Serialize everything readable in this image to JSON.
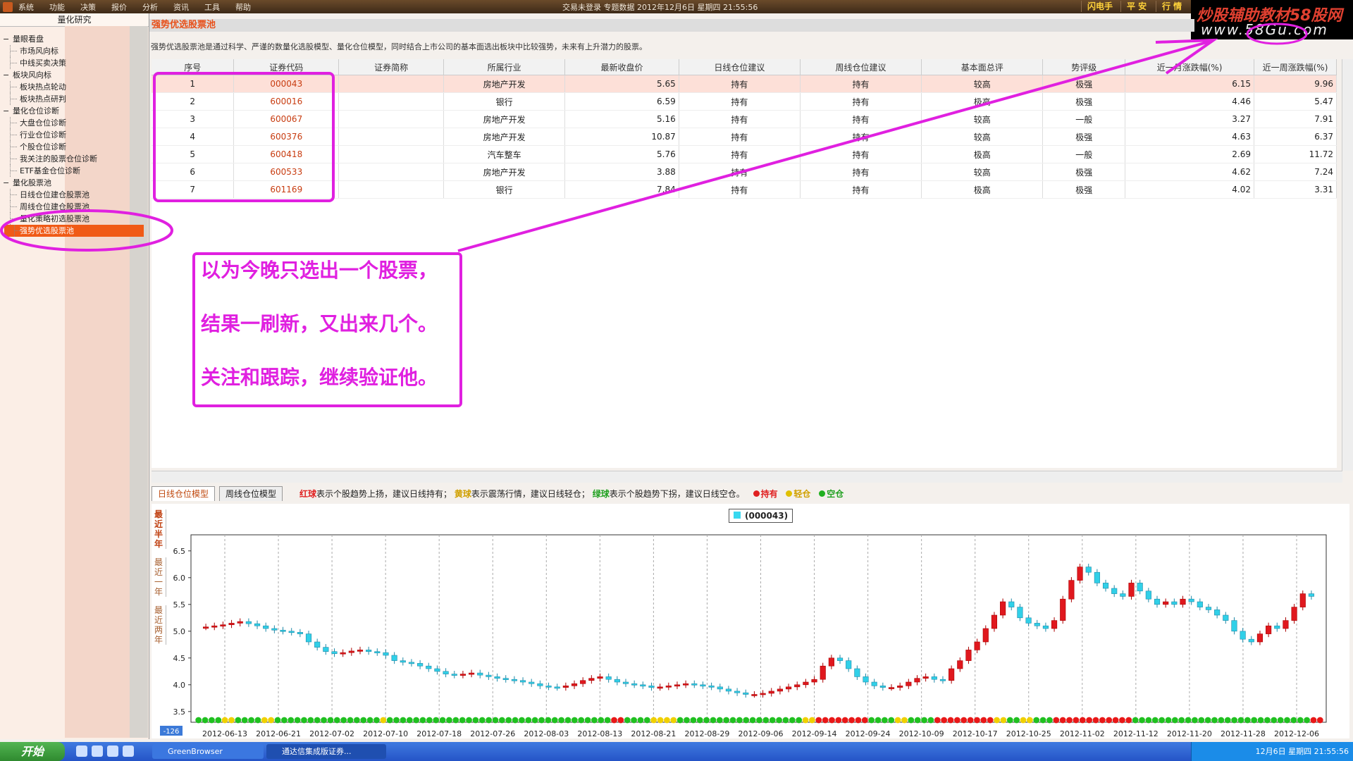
{
  "menubar": {
    "items": [
      "系统",
      "功能",
      "决策",
      "报价",
      "分析",
      "资讯",
      "工具",
      "帮助"
    ],
    "status": "交易未登录   专题数据  2012年12月6日  星期四  21:55:56",
    "right_buttons": [
      "闪电手",
      "平 安",
      "行 情"
    ]
  },
  "watermark": {
    "line1": "炒股辅助教材58股网",
    "line2": "www.58Gu.com"
  },
  "sidebar": {
    "header": "量化研究",
    "tree": [
      {
        "label": "量眼看盘",
        "level": 0
      },
      {
        "label": "市场风向标",
        "level": 1
      },
      {
        "label": "中线买卖决策",
        "level": 1
      },
      {
        "label": "板块风向标",
        "level": 0
      },
      {
        "label": "板块热点轮动",
        "level": 1
      },
      {
        "label": "板块热点研判",
        "level": 1
      },
      {
        "label": "量化仓位诊断",
        "level": 0
      },
      {
        "label": "大盘仓位诊断",
        "level": 1
      },
      {
        "label": "行业仓位诊断",
        "level": 1
      },
      {
        "label": "个股仓位诊断",
        "level": 1
      },
      {
        "label": "我关注的股票仓位诊断",
        "level": 1
      },
      {
        "label": "ETF基金仓位诊断",
        "level": 1
      },
      {
        "label": "量化股票池",
        "level": 0
      },
      {
        "label": "日线仓位建仓股票池",
        "level": 1
      },
      {
        "label": "周线仓位建仓股票池",
        "level": 1
      },
      {
        "label": "量化策略初选股票池",
        "level": 1
      },
      {
        "label": "强势优选股票池",
        "level": 1,
        "selected": true
      }
    ]
  },
  "main": {
    "title": "强势优选股票池",
    "description": "强势优选股票池是通过科学、严谨的数量化选股模型、量化仓位模型，同时结合上市公司的基本面选出板块中比较强势，未来有上升潜力的股票。"
  },
  "table": {
    "headers": [
      "序号",
      "证券代码",
      "证券简称",
      "所属行业",
      "最新收盘价",
      "日线仓位建议",
      "周线仓位建议",
      "基本面总评",
      "势评级",
      "近一月涨跌幅(%)",
      "近一周涨跌幅(%)"
    ],
    "rows": [
      [
        "1",
        "000043",
        "",
        "房地产开发",
        "5.65",
        "持有",
        "持有",
        "较高",
        "极强",
        "6.15",
        "9.96"
      ],
      [
        "2",
        "600016",
        "",
        "银行",
        "6.59",
        "持有",
        "持有",
        "极高",
        "极强",
        "4.46",
        "5.47"
      ],
      [
        "3",
        "600067",
        "",
        "房地产开发",
        "5.16",
        "持有",
        "持有",
        "较高",
        "一般",
        "3.27",
        "7.91"
      ],
      [
        "4",
        "600376",
        "",
        "房地产开发",
        "10.87",
        "持有",
        "持有",
        "较高",
        "极强",
        "4.63",
        "6.37"
      ],
      [
        "5",
        "600418",
        "",
        "汽车整车",
        "5.76",
        "持有",
        "持有",
        "极高",
        "一般",
        "2.69",
        "11.72"
      ],
      [
        "6",
        "600533",
        "",
        "房地产开发",
        "3.88",
        "持有",
        "持有",
        "较高",
        "极强",
        "4.62",
        "7.24"
      ],
      [
        "7",
        "601169",
        "",
        "银行",
        "7.84",
        "持有",
        "持有",
        "极高",
        "极强",
        "4.02",
        "3.31"
      ]
    ]
  },
  "bottom": {
    "tabs": [
      "日线仓位模型",
      "周线仓位模型"
    ],
    "legend": {
      "red": "红球",
      "red_text": "表示个股趋势上扬，建议日线持有；",
      "yellow": "黄球",
      "yellow_text": "表示震荡行情，建议日线轻仓；",
      "green": "绿球",
      "green_text": "表示个股趋势下拐，建议日线空仓。",
      "hold": "持有",
      "light": "轻仓",
      "empty": "空仓"
    },
    "side_tabs": [
      "最近半年",
      "最近一年",
      "最近两年"
    ],
    "chart_legend": "(000043)",
    "axis_marker": "-126"
  },
  "annotation": {
    "lines": [
      "以为今晚只选出一个股票，",
      "结果一刷新，又出来几个。",
      "关注和跟踪，继续验证他。"
    ]
  },
  "taskbar": {
    "start": "开始",
    "tasks": [
      "GreenBrowser",
      "通达信集成版证券..."
    ],
    "clock": "12月6日 星期四 21:55:56"
  },
  "chart_data": {
    "type": "candlestick",
    "title": "",
    "series_name": "(000043)",
    "ylim": [
      3.3,
      6.8
    ],
    "yticks": [
      3.5,
      4.0,
      4.5,
      5.0,
      5.5,
      6.0,
      6.5
    ],
    "x_labels": [
      "2012-06-13",
      "2012-06-21",
      "2012-07-02",
      "2012-07-10",
      "2012-07-18",
      "2012-07-26",
      "2012-08-03",
      "2012-08-13",
      "2012-08-21",
      "2012-08-29",
      "2012-09-06",
      "2012-09-14",
      "2012-09-24",
      "2012-10-09",
      "2012-10-17",
      "2012-10-25",
      "2012-11-02",
      "2012-11-12",
      "2012-11-20",
      "2012-11-28",
      "2012-12-06"
    ],
    "close_series": [
      5.08,
      5.1,
      5.12,
      5.15,
      5.18,
      5.14,
      5.1,
      5.05,
      5.02,
      5.0,
      4.98,
      4.95,
      4.8,
      4.7,
      4.62,
      4.58,
      4.6,
      4.63,
      4.65,
      4.62,
      4.6,
      4.55,
      4.45,
      4.42,
      4.4,
      4.35,
      4.3,
      4.25,
      4.2,
      4.18,
      4.2,
      4.22,
      4.18,
      4.15,
      4.12,
      4.1,
      4.08,
      4.05,
      4.02,
      3.98,
      3.96,
      3.95,
      3.98,
      4.02,
      4.08,
      4.12,
      4.15,
      4.1,
      4.05,
      4.02,
      4.0,
      3.98,
      3.95,
      3.96,
      3.98,
      4.0,
      4.02,
      4.0,
      3.98,
      3.96,
      3.92,
      3.88,
      3.85,
      3.82,
      3.82,
      3.84,
      3.88,
      3.92,
      3.96,
      4.0,
      4.05,
      4.1,
      4.35,
      4.5,
      4.45,
      4.3,
      4.15,
      4.05,
      3.98,
      3.95,
      3.95,
      3.98,
      4.05,
      4.12,
      4.15,
      4.1,
      4.08,
      4.3,
      4.45,
      4.65,
      4.8,
      5.05,
      5.3,
      5.55,
      5.45,
      5.25,
      5.15,
      5.1,
      5.05,
      5.2,
      5.6,
      5.95,
      6.2,
      6.1,
      5.9,
      5.8,
      5.7,
      5.65,
      5.9,
      5.75,
      5.6,
      5.5,
      5.55,
      5.5,
      5.6,
      5.55,
      5.45,
      5.4,
      5.3,
      5.2,
      5.0,
      4.85,
      4.8,
      4.95,
      5.1,
      5.05,
      5.2,
      5.45,
      5.7,
      5.65
    ],
    "signal_colors": [
      "g",
      "g",
      "g",
      "g",
      "y",
      "y",
      "g",
      "g",
      "g",
      "g",
      "y",
      "y",
      "g",
      "g",
      "g",
      "g",
      "g",
      "g",
      "g",
      "g",
      "g",
      "g",
      "g",
      "g",
      "g",
      "g",
      "g",
      "g",
      "y",
      "g",
      "g",
      "g",
      "g",
      "g",
      "g",
      "g",
      "g",
      "g",
      "g",
      "g",
      "g",
      "g",
      "g",
      "g",
      "g",
      "g",
      "g",
      "g",
      "g",
      "g",
      "g",
      "g",
      "g",
      "g",
      "g",
      "g",
      "g",
      "g",
      "g",
      "g",
      "g",
      "g",
      "g",
      "r",
      "r",
      "g",
      "g",
      "g",
      "g",
      "y",
      "y",
      "y",
      "y",
      "g",
      "g",
      "g",
      "g",
      "g",
      "g",
      "g",
      "g",
      "g",
      "g",
      "g",
      "g",
      "g",
      "g",
      "g",
      "g",
      "g",
      "g",
      "g",
      "y",
      "y",
      "r",
      "r",
      "r",
      "r",
      "r",
      "r",
      "r",
      "r",
      "g",
      "g",
      "g",
      "g",
      "y",
      "y",
      "g",
      "g",
      "g",
      "g",
      "r",
      "r",
      "r",
      "r",
      "r",
      "r",
      "r",
      "r",
      "r",
      "y",
      "y",
      "g",
      "g",
      "y",
      "y",
      "g",
      "g",
      "g",
      "r",
      "r",
      "r",
      "r",
      "r",
      "r",
      "r",
      "r",
      "r",
      "r",
      "r",
      "r",
      "g",
      "g",
      "g",
      "g",
      "g",
      "g",
      "g",
      "g",
      "g",
      "g",
      "g",
      "g",
      "g",
      "g",
      "g",
      "g",
      "g",
      "g",
      "g",
      "g",
      "g",
      "g",
      "g",
      "g",
      "g",
      "g",
      "g",
      "r",
      "r"
    ]
  }
}
